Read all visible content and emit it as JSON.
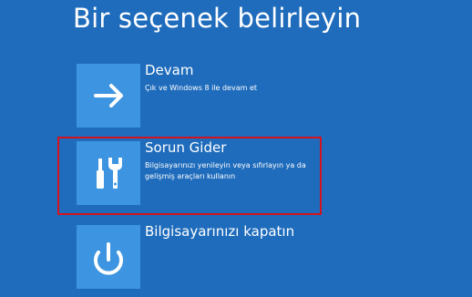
{
  "page": {
    "title": "Bir seçenek belirleyin"
  },
  "options": [
    {
      "title": "Devam",
      "description": "Çık ve Windows 8 ile devam et",
      "icon": "arrow-right-icon"
    },
    {
      "title": "Sorun Gider",
      "description": "Bilgisayarınızı yenileyin veya sıfırlayın ya da gelişmiş araçları kullanın",
      "icon": "tools-icon"
    },
    {
      "title": "Bilgisayarınızı kapatın",
      "description": "",
      "icon": "power-icon"
    }
  ],
  "colors": {
    "background": "#1f6cbc",
    "tile": "#3d94e0",
    "highlight": "#d3131f"
  }
}
